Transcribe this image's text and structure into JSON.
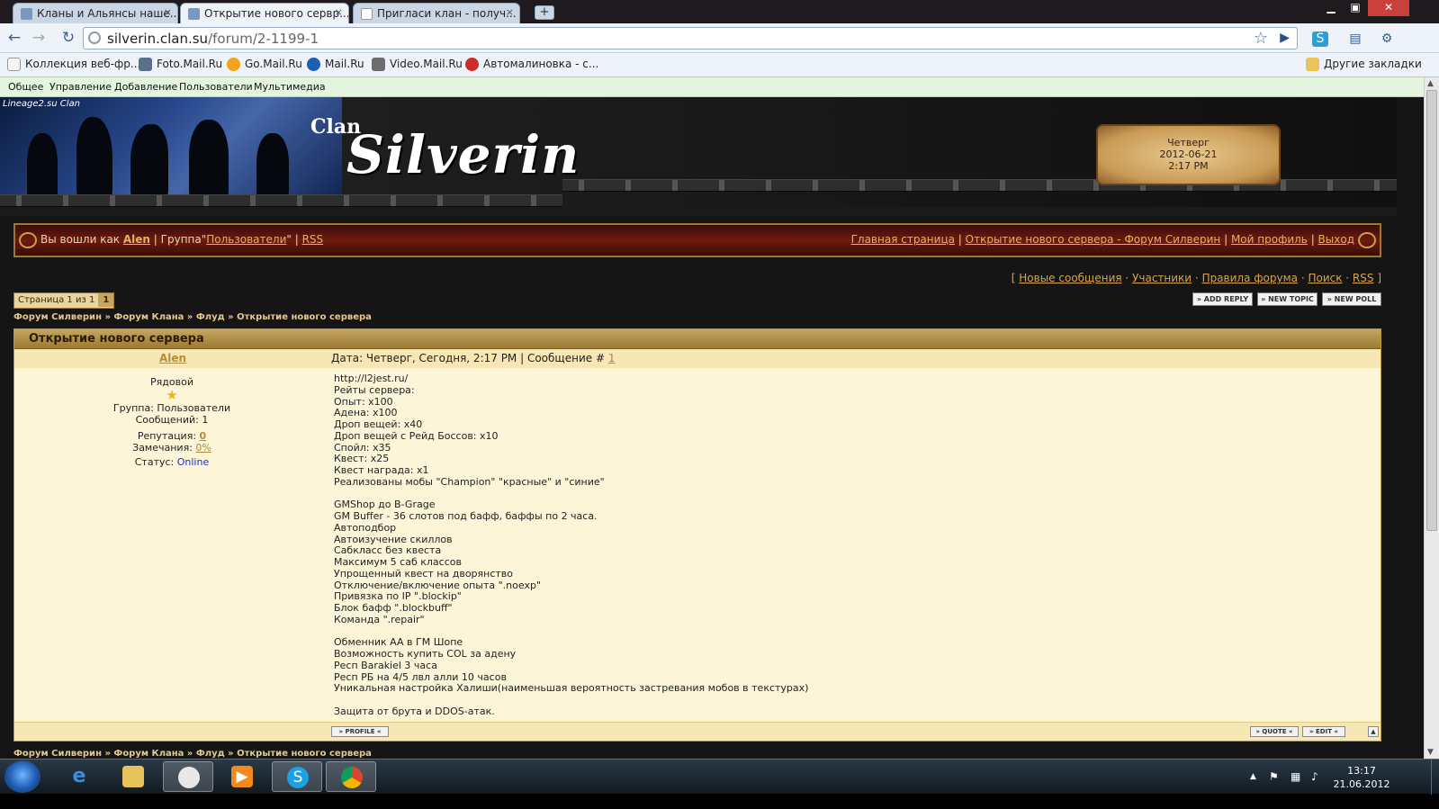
{
  "browser": {
    "tabs": [
      {
        "title": "Кланы и Альянсы наше..."
      },
      {
        "title": "Открытие нового сервр..."
      },
      {
        "title": "Пригласи клан - получ..."
      }
    ],
    "tab_close": "×",
    "new_tab": "+",
    "url_host": "silverin.clan.su",
    "url_path": "/forum/2-1199-1",
    "bookmarks": [
      {
        "label": "Коллекция веб-фр...",
        "color": "#f5f5f5"
      },
      {
        "label": "Foto.Mail.Ru",
        "color": "#5a6f8a"
      },
      {
        "label": "Go.Mail.Ru",
        "color": "#f0a419"
      },
      {
        "label": "Mail.Ru",
        "color": "#1d5fb3"
      },
      {
        "label": "Video.Mail.Ru",
        "color": "#6d6d6d"
      },
      {
        "label": "Автомалиновка - с...",
        "color": "#d02b2b"
      }
    ],
    "other_bookmarks": "Другие закладки"
  },
  "ucoz_menu": [
    "Общее",
    "Управление",
    "Добавление",
    "Пользователи",
    "Мультимедиа"
  ],
  "header": {
    "small_label": "Lineage2.su Clan",
    "clan_word": "Clan",
    "site_name": "Silverin",
    "clock": {
      "day": "Четверг",
      "date": "2012-06-21",
      "time": "2:17 PM"
    }
  },
  "userbar": {
    "logged_as": "Вы вошли как",
    "username": "Alen",
    "group_prefix": " | Группа\"",
    "group_name": "Пользователи",
    "group_suffix": "\" | ",
    "rss": "RSS",
    "right_links": [
      "Главная страница",
      "Открытие нового сервера - Форум Силверин",
      "Мой профиль",
      "Выход"
    ]
  },
  "forum_links": [
    "Новые сообщения",
    "Участники",
    "Правила форума",
    "Поиск",
    "RSS"
  ],
  "pager": {
    "label": "Страница 1 из 1",
    "page": "1"
  },
  "action_buttons": [
    "ADD REPLY",
    "NEW TOPIC",
    "NEW POLL"
  ],
  "breadcrumbs": "Форум Силверин » Форум Клана » Флуд » Открытие нового сервера",
  "post": {
    "topic_title": "Открытие нового сервера",
    "author": "Alen",
    "meta_text": "Дата: Четверг, Сегодня, 2:17 PM | Сообщение # ",
    "meta_num": "1",
    "rank": "Рядовой",
    "rank_star": "★",
    "group": "Группа: Пользователи",
    "messages": "Сообщений: 1",
    "reputation_label": "Репутация: ",
    "reputation_value": "0",
    "warnings_label": "Замечания: ",
    "warnings_value": "0%",
    "status_label": "Статус: ",
    "status_value": "Online",
    "body": "http://l2jest.ru/\nРейты сервера:\nОпыт: x100\nАдена: x100\nДроп вещей: x40\nДроп вещей с Рейд Боссов: x10\nСпойл: x35\nКвест: x25\nКвест награда: x1\nРеализованы мобы \"Champion\" \"красные\" и \"синие\"\n\nGMShop до B-Grage\nGM Buffer - 36 слотов под бафф, баффы по 2 часа.\nАвтоподбор\nАвтоизучение скиллов\nСабкласс без квеста\nМаксимум 5 саб классов\nУпрощенный квест на дворянство\nОтключение/включение опыта \".noexp\"\nПривязка по IP \".blockip\"\nБлок бафф \".blockbuff\"\nКоманда \".repair\"\n\nОбменник AA в ГМ Шопе\nВозможность купить COL за адену\nРесп Barakiel 3 часа\nРесп РБ на 4/5 лвл алли 10 часов\nУникальная настройка Халиши(наименьшая вероятность застревания мобов в текстурах)\n\nЗащита от брута и DDOS-атак.",
    "profile_btn": "PROFILE",
    "quote_btn": "QUOTE",
    "edit_btn": "EDIT"
  },
  "taskbar": {
    "time": "13:17",
    "date": "21.06.2012"
  },
  "colors": {
    "accent_gold": "#c08a2e",
    "online_blue": "#1a2fd0",
    "bar_red": "#6e1a0e"
  }
}
